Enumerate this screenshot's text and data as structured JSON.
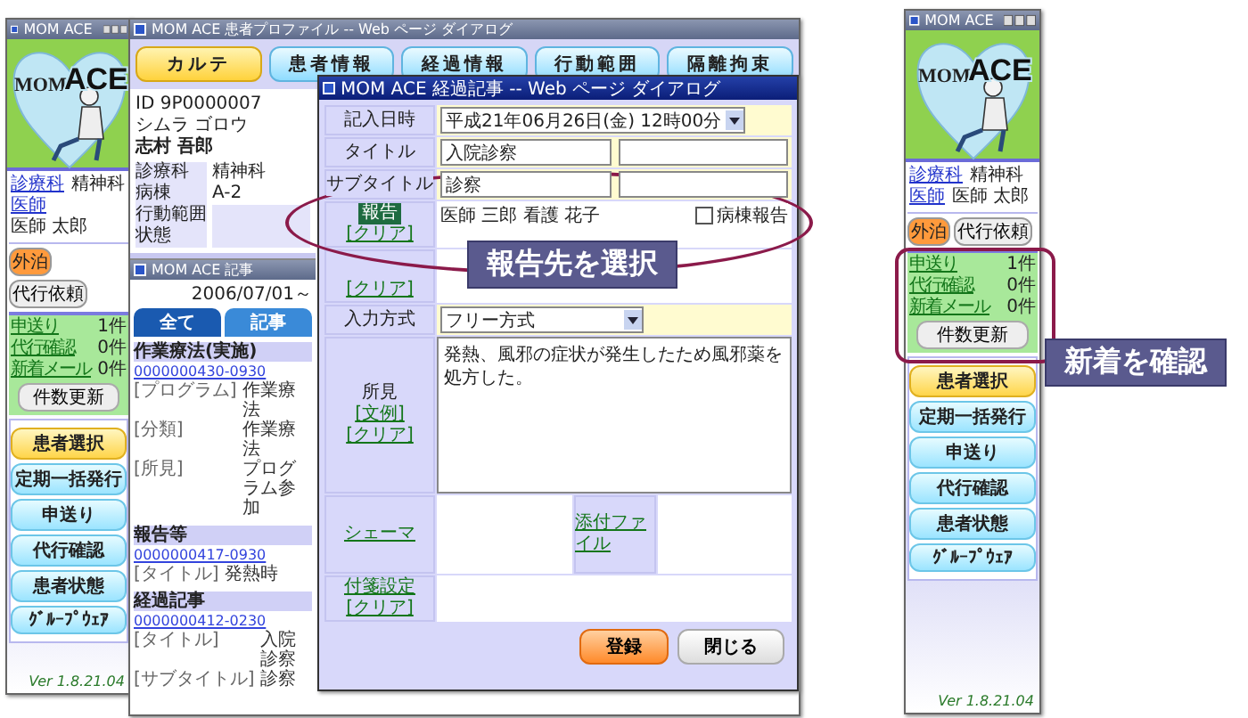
{
  "sidebars": [
    {
      "title": "MOM ACE",
      "logo": {
        "word_1": "MOM",
        "word_2": "ACE"
      },
      "info": [
        {
          "label": "診療科",
          "value": "精神科"
        },
        {
          "label": "医師",
          "value": "医師 太郎"
        }
      ],
      "tags": [
        {
          "label": "外泊",
          "highlighted": true
        },
        {
          "label": "代行依頼",
          "highlighted": false
        }
      ],
      "counts": [
        {
          "label": "申送り",
          "value": "1件"
        },
        {
          "label": "代行確認",
          "value": "0件"
        },
        {
          "label": "新着メール",
          "value": "0件"
        }
      ],
      "refresh": "件数更新",
      "menu": [
        {
          "label": "患者選択",
          "highlighted": true
        },
        {
          "label": "定期一括発行",
          "highlighted": false
        },
        {
          "label": "申送り",
          "highlighted": false
        },
        {
          "label": "代行確認",
          "highlighted": false
        },
        {
          "label": "患者状態",
          "highlighted": false
        },
        {
          "label": "ｸﾞﾙｰﾌﾟｳｪｱ",
          "highlighted": false
        }
      ],
      "version": "Ver 1.8.21.04"
    },
    {
      "title": "MOM ACE",
      "logo": {
        "word_1": "MOM",
        "word_2": "ACE"
      },
      "info": [
        {
          "label": "診療科",
          "value": "精神科"
        },
        {
          "label": "医師",
          "value": "医師 太郎"
        }
      ],
      "tags": [
        {
          "label": "外泊",
          "highlighted": true
        },
        {
          "label": "代行依頼",
          "highlighted": false
        }
      ],
      "counts": [
        {
          "label": "申送り",
          "value": "1件"
        },
        {
          "label": "代行確認",
          "value": "0件"
        },
        {
          "label": "新着メール",
          "value": "0件"
        }
      ],
      "refresh": "件数更新",
      "menu": [
        {
          "label": "患者選択",
          "highlighted": true
        },
        {
          "label": "定期一括発行",
          "highlighted": false
        },
        {
          "label": "申送り",
          "highlighted": false
        },
        {
          "label": "代行確認",
          "highlighted": false
        },
        {
          "label": "患者状態",
          "highlighted": false
        },
        {
          "label": "ｸﾞﾙｰﾌﾟｳｪｱ",
          "highlighted": false
        }
      ],
      "version": "Ver 1.8.21.04"
    }
  ],
  "main_window": {
    "title": "MOM ACE 患者プロファイル -- Web ページ ダイアログ",
    "tabs": [
      {
        "label": "カルテ",
        "selected": true
      },
      {
        "label": "患者情報",
        "selected": false
      },
      {
        "label": "経過情報",
        "selected": false
      },
      {
        "label": "行動範囲",
        "selected": false
      },
      {
        "label": "隔離拘束",
        "selected": false
      }
    ],
    "patient": {
      "id": "ID 9P0000007",
      "kana": "シムラ ゴロウ",
      "name": "志村 吾郎",
      "fields": [
        {
          "label": "診療科",
          "value": "精神科"
        },
        {
          "label": "病棟",
          "value": "A-2"
        },
        {
          "label": "行動範囲"
        },
        {
          "label": "状態"
        }
      ]
    },
    "records": {
      "title": "MOM ACE 記事",
      "date_range": "2006/07/01～",
      "tabs": [
        {
          "label": "全て",
          "selected": true
        },
        {
          "label": "記事",
          "selected": false
        }
      ],
      "groups": [
        {
          "header": "作業療法(実施)",
          "id": "0000000430-0930",
          "fields": [
            {
              "label": "[プログラム]",
              "value": "作業療法"
            },
            {
              "label": "[分類]",
              "value": "作業療法"
            },
            {
              "label": "[所見]",
              "value": "プログラム参加"
            }
          ]
        },
        {
          "header": "報告等",
          "id": "0000000417-0930",
          "fields": [
            {
              "label": "[タイトル]",
              "value": "発熱時"
            }
          ]
        },
        {
          "header": "経過記事",
          "id": "0000000412-0230",
          "fields": [
            {
              "label": "[タイトル]",
              "value": "入院診察"
            },
            {
              "label": "[サブタイトル]",
              "value": "診察"
            }
          ]
        }
      ]
    }
  },
  "dialog": {
    "title": "MOM ACE 経過記事 -- Web ページ ダイアログ",
    "datetime": {
      "label": "記入日時",
      "value": "平成21年06月26日(金) 12時00分"
    },
    "title_field": {
      "label": "タイトル",
      "value": "入院診察"
    },
    "subtitle_field": {
      "label": "サブタイトル",
      "value": "診察"
    },
    "report": {
      "label": "報告",
      "clear": "[クリア]",
      "recipients": "医師 三郎 看護 花子",
      "ward_report": {
        "label": "病棟報告",
        "checked": false
      }
    },
    "second_clear": "[クリア]",
    "input_mode": {
      "label": "入力方式",
      "value": "フリー方式"
    },
    "findings": {
      "label": "所見",
      "sample": "[文例]",
      "clear": "[クリア]",
      "text": "発熱、風邪の症状が発生したため風邪薬を処方した。"
    },
    "schema_link": "シェーマ",
    "attachment_link": "添付ファイル",
    "sticky": {
      "label": "付箋設定",
      "clear": "[クリア]"
    },
    "buttons": [
      {
        "label": "登録",
        "kind": "primary"
      },
      {
        "label": "閉じる",
        "kind": "plain"
      }
    ]
  },
  "callouts": [
    {
      "label": "報告先を選択",
      "kind": "ellipse"
    },
    {
      "label": "新着を確認",
      "kind": "frame"
    }
  ]
}
